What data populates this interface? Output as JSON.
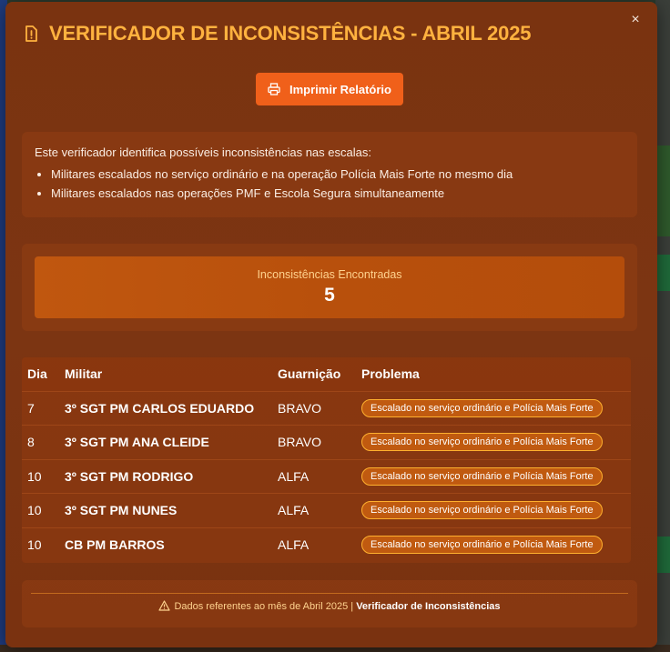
{
  "modal": {
    "title": "VERIFICADOR DE INCONSISTÊNCIAS - ABRIL 2025",
    "close_label": "×",
    "print_label": "Imprimir Relatório"
  },
  "info": {
    "intro": "Este verificador identifica possíveis inconsistências nas escalas:",
    "items": [
      "Militares escalados no serviço ordinário e na operação Polícia Mais Forte no mesmo dia",
      "Militares escalados nas operações PMF e Escola Segura simultaneamente"
    ]
  },
  "summary": {
    "label": "Inconsistências Encontradas",
    "count": "5"
  },
  "table": {
    "headers": [
      "Dia",
      "Militar",
      "Guarnição",
      "Problema"
    ],
    "rows": [
      {
        "dia": "7",
        "militar": "3º SGT PM CARLOS EDUARDO",
        "guarnicao": "BRAVO",
        "problema": "Escalado no serviço ordinário e Polícia Mais Forte"
      },
      {
        "dia": "8",
        "militar": "3º SGT PM ANA CLEIDE",
        "guarnicao": "BRAVO",
        "problema": "Escalado no serviço ordinário e Polícia Mais Forte"
      },
      {
        "dia": "10",
        "militar": "3º SGT PM RODRIGO",
        "guarnicao": "ALFA",
        "problema": "Escalado no serviço ordinário e Polícia Mais Forte"
      },
      {
        "dia": "10",
        "militar": "3º SGT PM NUNES",
        "guarnicao": "ALFA",
        "problema": "Escalado no serviço ordinário e Polícia Mais Forte"
      },
      {
        "dia": "10",
        "militar": "CB PM BARROS",
        "guarnicao": "ALFA",
        "problema": "Escalado no serviço ordinário e Polícia Mais Forte"
      }
    ]
  },
  "footer": {
    "text": "Dados referentes ao mês de Abril 2025 | ",
    "brand": "Verificador de Inconsistências"
  },
  "colors": {
    "title": "#ffb23f",
    "print_button": "#f0601a",
    "badge_border": "#ffb02e"
  },
  "icons": {
    "title": "alert-file-icon",
    "print": "printer-icon",
    "close": "close-icon",
    "footer": "warning-triangle-icon"
  }
}
